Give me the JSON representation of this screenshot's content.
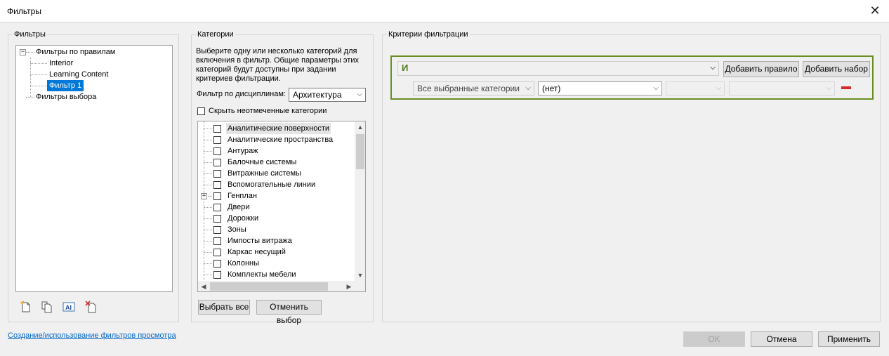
{
  "window": {
    "title": "Фильтры",
    "close": "✕"
  },
  "filters_panel": {
    "title": "Фильтры",
    "tree": {
      "rule_group": "Фильтры по правилам",
      "items": [
        "Interior",
        "Learning Content",
        "Фильтр 1"
      ],
      "selection_group": "Фильтры выбора"
    },
    "expander_minus": "−"
  },
  "categories_panel": {
    "title": "Категории",
    "description": "Выберите одну или несколько категорий для включения в фильтр. Общие параметры этих категорий будут доступны при задании критериев фильтрации.",
    "discipline_label": "Фильтр по дисциплинам:",
    "discipline_value": "Архитектура",
    "hide_unchecked_label": "Скрыть неотмеченные категории",
    "items": [
      "Аналитические поверхности",
      "Аналитические пространства",
      "Антураж",
      "Балочные системы",
      "Витражные системы",
      "Вспомогательные линии",
      "Генплан",
      "Двери",
      "Дорожки",
      "Зоны",
      "Импосты витража",
      "Каркас несущий",
      "Колонны",
      "Комплекты мебели"
    ],
    "expander_plus": "+",
    "select_all": "Выбрать все",
    "deselect": "Отменить выбор"
  },
  "criteria_panel": {
    "title": "Критерии фильтрации",
    "operator": "И",
    "add_rule": "Добавить правило",
    "add_set": "Добавить набор",
    "rule": {
      "category": "Все выбранные категории",
      "parameter": "(нет)",
      "condition": "",
      "value": ""
    }
  },
  "footer": {
    "help_link": "Создание/использование фильтров просмотра",
    "ok": "OK",
    "cancel": "Отмена",
    "apply": "Применить"
  },
  "icons": {
    "dropdown": "⌵",
    "scroll_up": "▲",
    "scroll_down": "▼",
    "scroll_left": "◀",
    "scroll_right": "▶"
  },
  "colors": {
    "selection": "#0078d7",
    "criteria_border": "#6b8e23",
    "remove_rule": "#d42c2c",
    "link": "#0066cc"
  }
}
